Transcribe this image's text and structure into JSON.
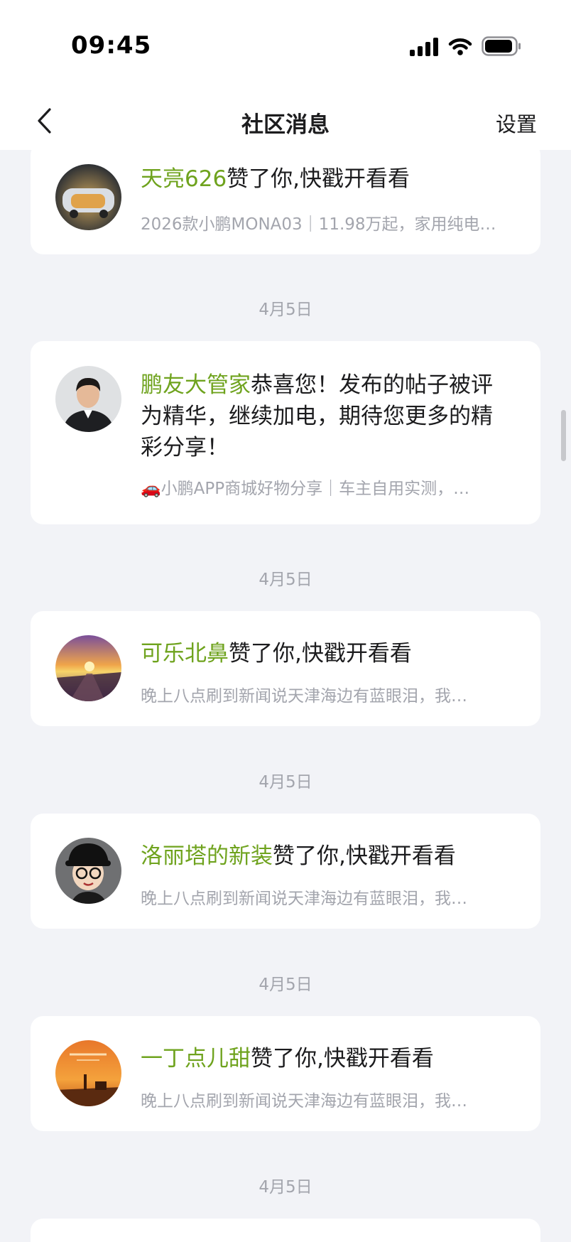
{
  "status_bar": {
    "time": "09:45"
  },
  "nav": {
    "title": "社区消息",
    "settings_label": "设置"
  },
  "items": [
    {
      "user": "天亮626",
      "action": "赞了你,快戳开看看",
      "preview": "2026款小鹏MONA03｜11.98万起，家用纯电…"
    },
    {
      "date": "4月5日",
      "user": "鹏友大管家",
      "action": "恭喜您！发布的帖子被评为精华，继续加电，期待您更多的精彩分享！",
      "preview": "🚗小鹏APP商城好物分享｜车主自用实测，…"
    },
    {
      "date": "4月5日",
      "user": "可乐北鼻",
      "action": "赞了你,快戳开看看",
      "preview": "晚上八点刷到新闻说天津海边有蓝眼泪，我…"
    },
    {
      "date": "4月5日",
      "user": "洛丽塔的新装",
      "action": "赞了你,快戳开看看",
      "preview": "晚上八点刷到新闻说天津海边有蓝眼泪，我…"
    },
    {
      "date": "4月5日",
      "user": "一丁点儿甜",
      "action": "赞了你,快戳开看看",
      "preview": "晚上八点刷到新闻说天津海边有蓝眼泪，我…"
    },
    {
      "date": "4月5日"
    }
  ],
  "colors": {
    "username": "#6fa31e",
    "secondary_text": "#a3a5ad",
    "background": "#f2f3f7",
    "card": "#ffffff"
  },
  "icons": [
    "back-arrow-icon",
    "cellular-signal-icon",
    "wifi-icon",
    "battery-icon"
  ]
}
